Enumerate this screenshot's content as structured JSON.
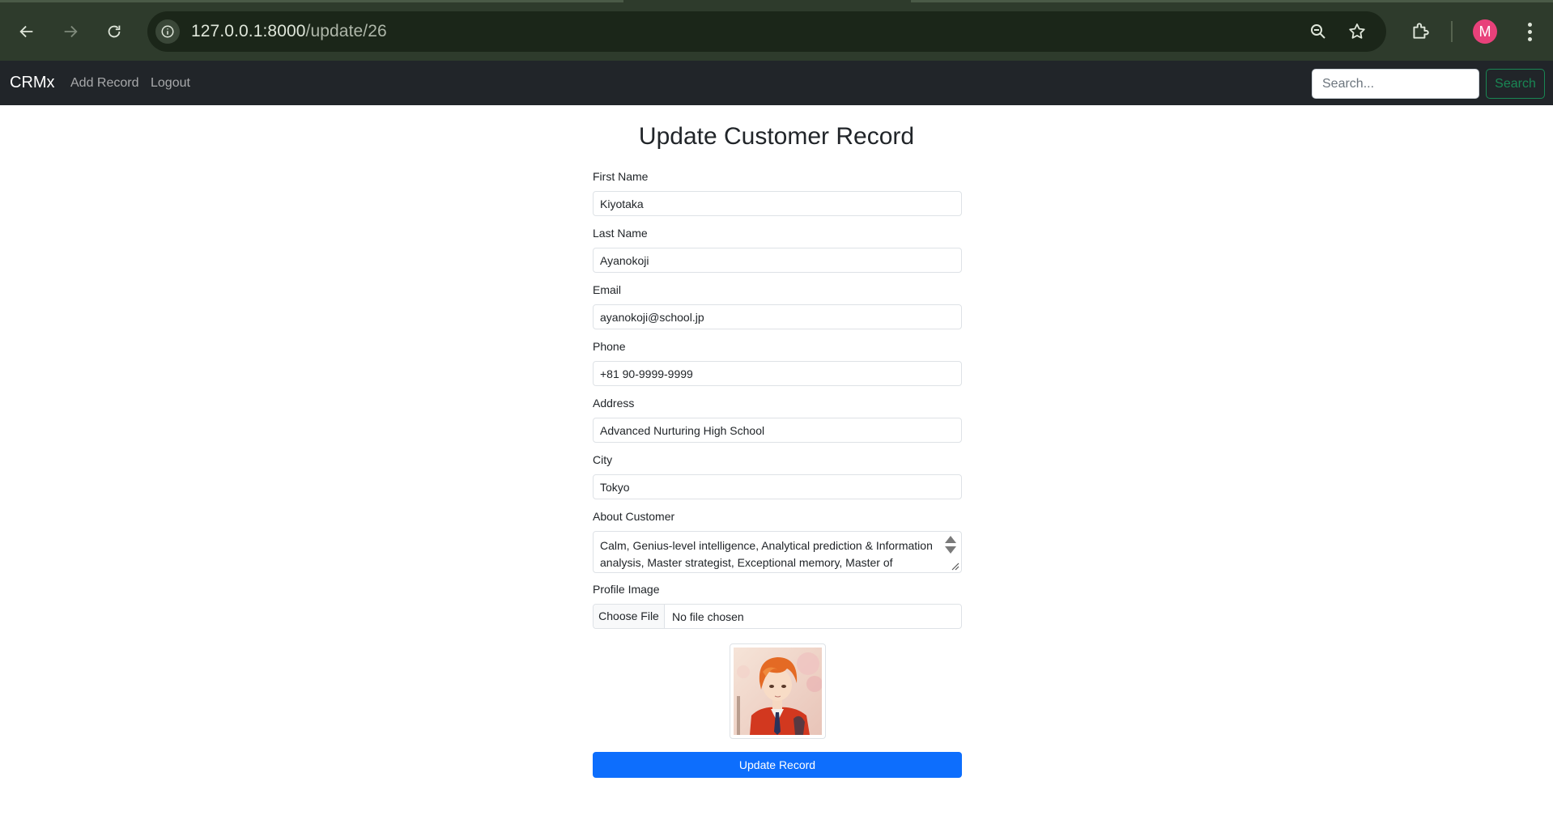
{
  "browser": {
    "url_host": "127.0.0.1:8000",
    "url_path": "/update/26",
    "profile_initial": "M"
  },
  "navbar": {
    "brand": "CRMx",
    "links": [
      "Add Record",
      "Logout"
    ],
    "search_placeholder": "Search...",
    "search_button": "Search"
  },
  "form": {
    "title": "Update Customer Record",
    "fields": {
      "first_name": {
        "label": "First Name",
        "value": "Kiyotaka"
      },
      "last_name": {
        "label": "Last Name",
        "value": "Ayanokoji"
      },
      "email": {
        "label": "Email",
        "value": "ayanokoji@school.jp"
      },
      "phone": {
        "label": "Phone",
        "value": "+81 90-9999-9999"
      },
      "address": {
        "label": "Address",
        "value": "Advanced Nurturing High School"
      },
      "city": {
        "label": "City",
        "value": "Tokyo"
      },
      "about": {
        "label": "About Customer",
        "value": "Calm, Genius-level intelligence, Analytical prediction & Information analysis, Master strategist, Exceptional memory, Master of"
      },
      "profile_image": {
        "label": "Profile Image",
        "button": "Choose File",
        "status": "No file chosen"
      }
    },
    "submit": "Update Record"
  },
  "colors": {
    "chrome_bg": "#2e3b2c",
    "navbar_bg": "#212529",
    "primary": "#0d6efd",
    "success": "#198754"
  }
}
